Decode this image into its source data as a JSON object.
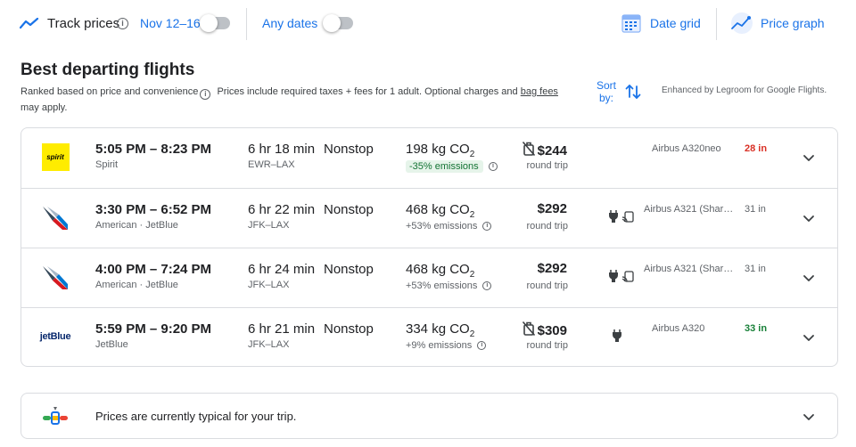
{
  "topbar": {
    "track_label": "Track prices",
    "track_dates": "Nov 12–16",
    "any_dates": "Any dates",
    "date_grid": "Date grid",
    "price_graph": "Price graph"
  },
  "section": {
    "title": "Best departing flights",
    "ranked": "Ranked based on price and convenience",
    "prices_note": "Prices include required taxes + fees for 1 adult. Optional charges and",
    "bag_fees": "bag fees",
    "may_apply": "may apply.",
    "sort_label": "Sort by:",
    "enhanced": "Enhanced by Legroom for Google Flights."
  },
  "flights": [
    {
      "times": "5:05 PM – 8:23 PM",
      "airline": "Spirit",
      "duration": "6 hr 18 min",
      "route": "EWR–LAX",
      "stops": "Nonstop",
      "co2_value": "198 kg CO",
      "co2_sub": "2",
      "emissions": "-35% emissions",
      "price": "$244",
      "price_note": "round trip",
      "aircraft": "Airbus A320neo",
      "legroom": "28 in"
    },
    {
      "times": "3:30 PM – 6:52 PM",
      "airline": "American · JetBlue",
      "duration": "6 hr 22 min",
      "route": "JFK–LAX",
      "stops": "Nonstop",
      "co2_value": "468 kg CO",
      "co2_sub": "2",
      "emissions": "+53% emissions",
      "price": "$292",
      "price_note": "round trip",
      "aircraft": "Airbus A321 (Shar…",
      "legroom": "31 in"
    },
    {
      "times": "4:00 PM – 7:24 PM",
      "airline": "American · JetBlue",
      "duration": "6 hr 24 min",
      "route": "JFK–LAX",
      "stops": "Nonstop",
      "co2_value": "468 kg CO",
      "co2_sub": "2",
      "emissions": "+53% emissions",
      "price": "$292",
      "price_note": "round trip",
      "aircraft": "Airbus A321 (Shar…",
      "legroom": "31 in"
    },
    {
      "times": "5:59 PM – 9:20 PM",
      "airline": "JetBlue",
      "duration": "6 hr 21 min",
      "route": "JFK–LAX",
      "stops": "Nonstop",
      "co2_value": "334 kg CO",
      "co2_sub": "2",
      "emissions": "+9% emissions",
      "price": "$309",
      "price_note": "round trip",
      "aircraft": "Airbus A320",
      "legroom": "33 in"
    }
  ],
  "logos": {
    "spirit": "spirit",
    "jetblue": "jetBlue"
  },
  "typical": {
    "message": "Prices are currently typical for your trip."
  },
  "colors": {
    "link_blue": "#1a73e8",
    "legroom_bad": "#d93025",
    "legroom_good": "#188038",
    "emissions_good_bg": "#e6f4ea"
  }
}
